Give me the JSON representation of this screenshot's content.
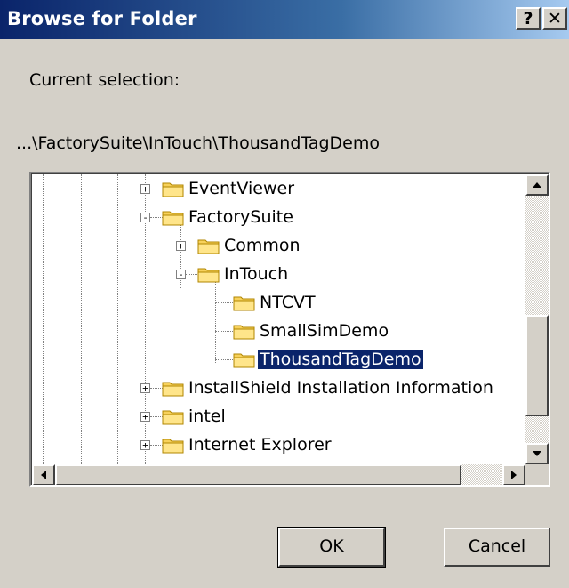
{
  "dialog": {
    "title": "Browse for Folder",
    "help_button": "?",
    "close_button": "✕"
  },
  "current_selection": {
    "label": "Current selection:",
    "path": "...\\FactorySuite\\InTouch\\ThousandTagDemo"
  },
  "tree": {
    "selected": "ThousandTagDemo",
    "items": [
      {
        "label": "EventViewer",
        "expander": "+"
      },
      {
        "label": "FactorySuite",
        "expander": "-"
      },
      {
        "label": "Common",
        "expander": "+"
      },
      {
        "label": "InTouch",
        "expander": "-"
      },
      {
        "label": "NTCVT",
        "expander": ""
      },
      {
        "label": "SmallSimDemo",
        "expander": ""
      },
      {
        "label": "ThousandTagDemo",
        "expander": ""
      },
      {
        "label": "InstallShield Installation Information",
        "expander": "+"
      },
      {
        "label": "intel",
        "expander": "+"
      },
      {
        "label": "Internet Explorer",
        "expander": "+"
      }
    ]
  },
  "buttons": {
    "ok": "OK",
    "cancel": "Cancel"
  },
  "colors": {
    "title_bar_start": "#0a246a",
    "title_bar_end": "#a6caf0",
    "selection": "#0a246a",
    "dialog_face": "#d4d0c8"
  }
}
